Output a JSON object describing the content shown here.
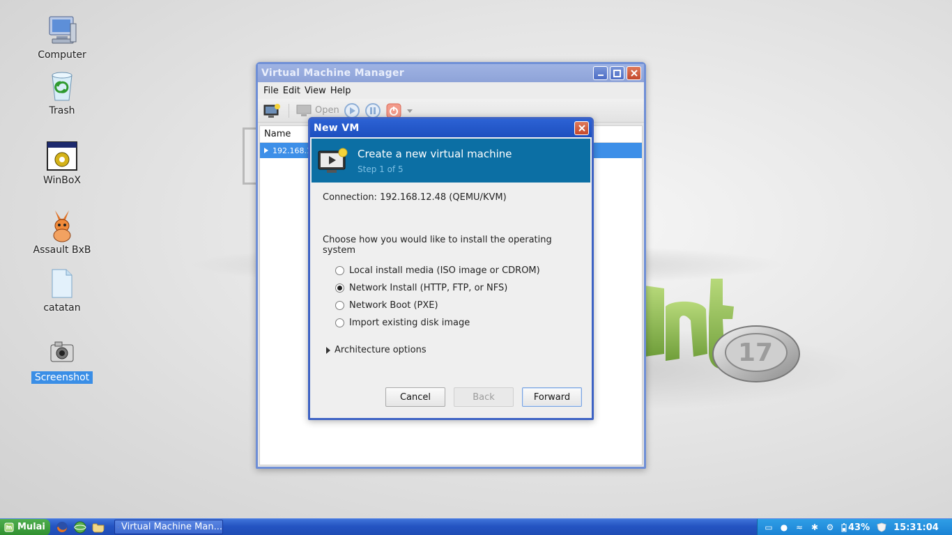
{
  "desktop": {
    "icons": [
      {
        "label": "Computer"
      },
      {
        "label": "Trash"
      },
      {
        "label": "WinBoX"
      },
      {
        "label": "Assault BxB"
      },
      {
        "label": "catatan"
      },
      {
        "label": "Screenshot"
      }
    ],
    "wallpaper_badge": "17"
  },
  "vmm_window": {
    "title": "Virtual Machine Manager",
    "menu": [
      "File",
      "Edit",
      "View",
      "Help"
    ],
    "toolbar": {
      "open_label": "Open"
    },
    "list_header": "Name",
    "rows": [
      "192.168.12.48 (QEMU/KVM)"
    ]
  },
  "new_vm_dialog": {
    "title": "New VM",
    "heading": "Create a new virtual machine",
    "step": "Step 1 of 5",
    "connection": "Connection: 192.168.12.48 (QEMU/KVM)",
    "prompt": "Choose how you would like to install the operating system",
    "options": [
      {
        "label": "Local install media (ISO image or CDROM)",
        "checked": false
      },
      {
        "label": "Network Install (HTTP, FTP, or NFS)",
        "checked": true
      },
      {
        "label": "Network Boot (PXE)",
        "checked": false
      },
      {
        "label": "Import existing disk image",
        "checked": false
      }
    ],
    "expander": "Architecture options",
    "buttons": {
      "cancel": "Cancel",
      "back": "Back",
      "forward": "Forward"
    }
  },
  "taskbar": {
    "start_label": "Mulai",
    "task_label": "Virtual Machine Man...",
    "battery": "43%",
    "clock": "15:31:04"
  },
  "colors": {
    "accent": "#3d8fe8",
    "dialog_banner": "#0c6fa4",
    "taskbar": "#2454c2",
    "start_green": "#3f9e3f"
  }
}
